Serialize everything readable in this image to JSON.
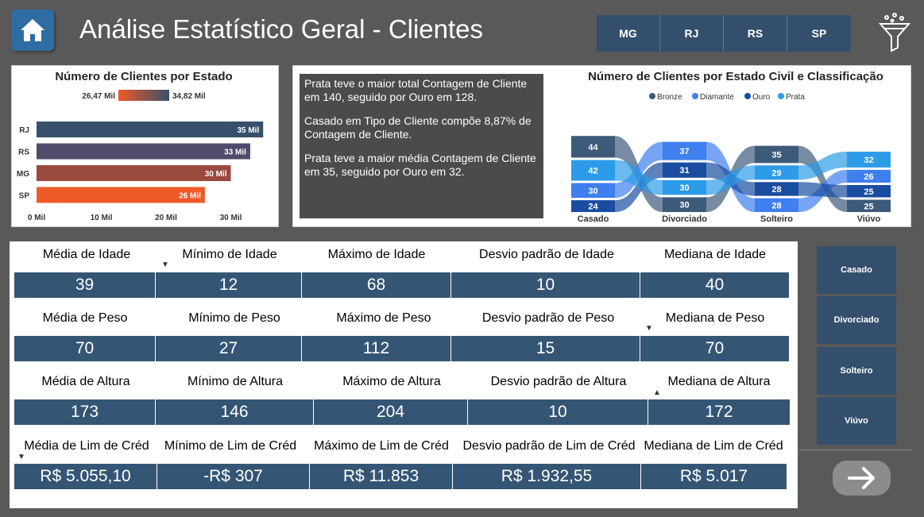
{
  "title": "Análise Estatístico Geral - Clientes",
  "state_buttons": [
    "MG",
    "RJ",
    "RS",
    "SP"
  ],
  "bar_card": {
    "title": "Número de Clientes por Estado",
    "legend_min": "26,47 Mil",
    "legend_max": "34,82 Mil"
  },
  "insights": [
    "Prata teve o maior total Contagem de Cliente em 140, seguido por Ouro em 128.",
    "Casado em Tipo de Cliente  compõe 8,87% de Contagem de Cliente.",
    "Prata teve a maior média Contagem de Cliente em 35, seguido por Ouro em 32."
  ],
  "sankey_card": {
    "title": "Número de Clientes por Estado Civil e Classificação",
    "legend": [
      "Bronze",
      "Diamante",
      "Ouro",
      "Prata"
    ]
  },
  "colors": {
    "Bronze": "#3d5a7a",
    "Diamante": "#3f7fee",
    "Ouro": "#1a4da0",
    "Prata": "#2c9be8",
    "bar_high": "#38506b",
    "bar_mid1": "#514a6a",
    "bar_mid2": "#9a4a3e",
    "bar_low": "#f05a28"
  },
  "chart_data": [
    {
      "type": "bar",
      "orientation": "horizontal",
      "title": "Número de Clientes por Estado",
      "categories": [
        "RJ",
        "RS",
        "MG",
        "SP"
      ],
      "values": [
        35,
        33,
        30,
        26
      ],
      "data_labels": [
        "35 Mil",
        "33 Mil",
        "30 Mil",
        "26 Mil"
      ],
      "xticks": [
        "0 Mil",
        "10 Mil",
        "20 Mil",
        "30 Mil"
      ],
      "xlim": [
        0,
        40
      ],
      "color_scale": {
        "min_label": "26,47 Mil",
        "max_label": "34,82 Mil"
      }
    },
    {
      "type": "sankey",
      "title": "Número de Clientes por Estado Civil e Classificação",
      "categories": [
        "Casado",
        "Divorciado",
        "Solteiro",
        "Viúvo"
      ],
      "series": [
        {
          "name": "Bronze",
          "values": [
            44,
            30,
            35,
            25
          ]
        },
        {
          "name": "Diamante",
          "values": [
            30,
            37,
            28,
            26
          ]
        },
        {
          "name": "Ouro",
          "values": [
            24,
            31,
            28,
            25
          ]
        },
        {
          "name": "Prata",
          "values": [
            42,
            30,
            29,
            32
          ]
        }
      ]
    }
  ],
  "stats": [
    {
      "labels": [
        "Média de Idade",
        "Mínimo de Idade",
        "Máximo de Idade",
        "Desvio padrão de Idade",
        "Mediana de Idade"
      ],
      "values": [
        "39",
        "12",
        "68",
        "10",
        "40"
      ]
    },
    {
      "labels": [
        "Média de Peso",
        "Mínimo de Peso",
        "Máximo de Peso",
        "Desvio padrão de Peso",
        "Mediana de Peso"
      ],
      "values": [
        "70",
        "27",
        "112",
        "15",
        "70"
      ]
    },
    {
      "labels": [
        "Média de Altura",
        "Mínimo de Altura",
        "Máximo de Altura",
        "Desvio padrão de Altura",
        "Mediana de Altura"
      ],
      "values": [
        "173",
        "146",
        "204",
        "10",
        "172"
      ]
    },
    {
      "labels": [
        "Média de Lim de Créd",
        "Mínimo de Lim de Créd",
        "Máximo de Lim de Créd",
        "Desvio padrão de Lim de Créd",
        "Mediana de Lim de Créd"
      ],
      "values": [
        "R$ 5.055,10",
        "-R$ 307",
        "R$ 11.853",
        "R$ 1.932,55",
        "R$ 5.017"
      ]
    }
  ],
  "civil_buttons": [
    "Casado",
    "Divorciado",
    "Solteiro",
    "Viúvo"
  ],
  "icons": {
    "home": "home-icon",
    "filter": "filter-icon",
    "next": "arrow-right-icon"
  }
}
